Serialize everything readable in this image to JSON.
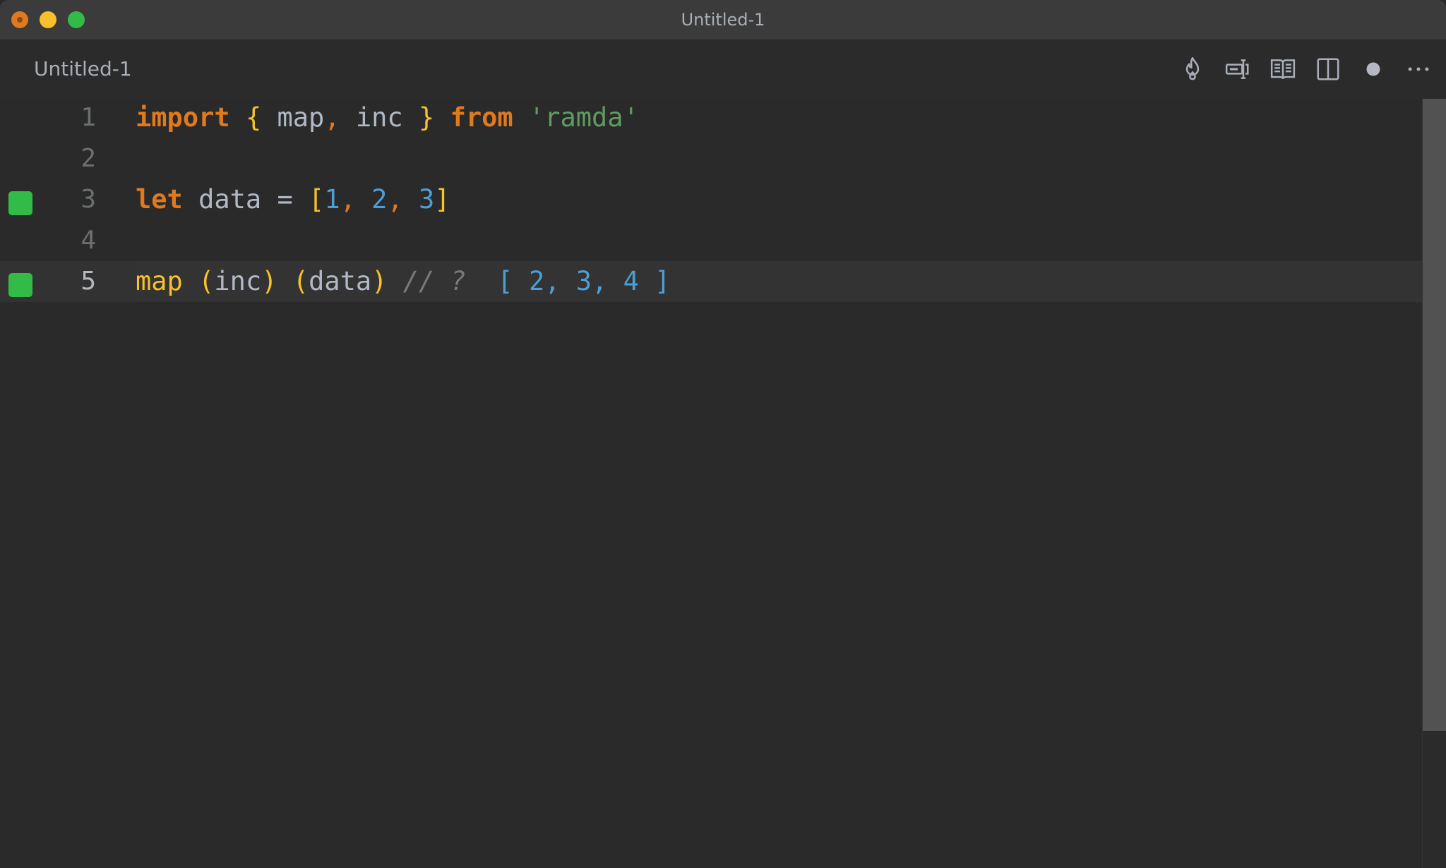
{
  "window": {
    "title": "Untitled-1",
    "traffic_lights": [
      "close",
      "minimize",
      "maximize"
    ]
  },
  "tab": {
    "title": "Untitled-1",
    "actions": [
      {
        "name": "quokka-flame-icon"
      },
      {
        "name": "rename-symbol-icon"
      },
      {
        "name": "open-preview-icon"
      },
      {
        "name": "split-editor-icon"
      },
      {
        "name": "unsaved-dot-icon"
      },
      {
        "name": "more-actions-icon"
      }
    ]
  },
  "editor": {
    "lines": [
      {
        "number": "1",
        "marker": false,
        "tokens": [
          {
            "t": "import",
            "c": "kw"
          },
          {
            "t": " ",
            "c": ""
          },
          {
            "t": "{",
            "c": "brace"
          },
          {
            "t": " map",
            "c": ""
          },
          {
            "t": ",",
            "c": "punc"
          },
          {
            "t": " inc ",
            "c": ""
          },
          {
            "t": "}",
            "c": "brace"
          },
          {
            "t": " ",
            "c": ""
          },
          {
            "t": "from",
            "c": "kw"
          },
          {
            "t": " ",
            "c": ""
          },
          {
            "t": "'ramda'",
            "c": "str"
          }
        ]
      },
      {
        "number": "2",
        "marker": false,
        "tokens": []
      },
      {
        "number": "3",
        "marker": true,
        "tokens": [
          {
            "t": "let",
            "c": "kw"
          },
          {
            "t": " data = ",
            "c": ""
          },
          {
            "t": "[",
            "c": "brace"
          },
          {
            "t": "1",
            "c": "num"
          },
          {
            "t": ",",
            "c": "punc"
          },
          {
            "t": " ",
            "c": ""
          },
          {
            "t": "2",
            "c": "num"
          },
          {
            "t": ",",
            "c": "punc"
          },
          {
            "t": " ",
            "c": ""
          },
          {
            "t": "3",
            "c": "num"
          },
          {
            "t": "]",
            "c": "brace"
          }
        ]
      },
      {
        "number": "4",
        "marker": false,
        "tokens": []
      },
      {
        "number": "5",
        "marker": true,
        "current": true,
        "tokens": [
          {
            "t": "map",
            "c": "fn"
          },
          {
            "t": " ",
            "c": ""
          },
          {
            "t": "(",
            "c": "brace"
          },
          {
            "t": "inc",
            "c": ""
          },
          {
            "t": ")",
            "c": "brace"
          },
          {
            "t": " ",
            "c": ""
          },
          {
            "t": "(",
            "c": "brace"
          },
          {
            "t": "data",
            "c": ""
          },
          {
            "t": ")",
            "c": "brace"
          },
          {
            "t": " // ?",
            "c": "cmt"
          },
          {
            "t": "  [ 2, 3, 4 ]",
            "c": "result"
          }
        ]
      }
    ]
  },
  "colors": {
    "keyword": "#e07a1f",
    "brace": "#f6c12c",
    "string": "#5f9b62",
    "number": "#4d9ed4",
    "coverage_marker": "#33bb48",
    "background": "#2a2a2a"
  }
}
